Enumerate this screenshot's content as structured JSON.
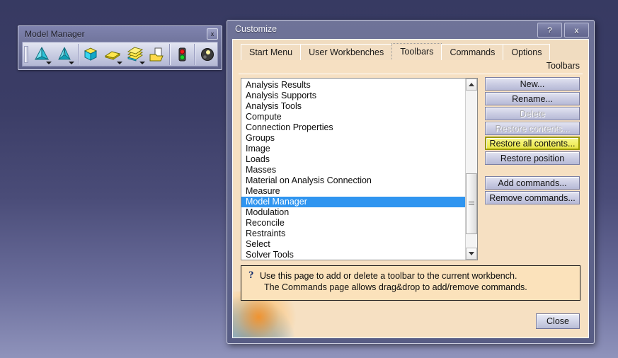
{
  "desktop": {
    "gradient_top": "#373a62",
    "gradient_bottom": "#8f93bb"
  },
  "model_manager_window": {
    "title": "Model Manager",
    "close_label": "x",
    "toolbar_groups": [
      {
        "buttons": [
          {
            "icon": "cone-mesh-icon",
            "has_dropdown": true
          },
          {
            "icon": "surface-mesh-icon",
            "has_dropdown": true
          }
        ]
      },
      {
        "buttons": [
          {
            "icon": "yellow-cube-icon",
            "has_dropdown": false
          },
          {
            "icon": "yellow-sheet-icon",
            "has_dropdown": true
          },
          {
            "icon": "yellow-stack-icon",
            "has_dropdown": true
          },
          {
            "icon": "open-folder-icon",
            "has_dropdown": false
          }
        ]
      },
      {
        "buttons": [
          {
            "icon": "traffic-light-icon",
            "has_dropdown": false
          }
        ]
      },
      {
        "buttons": [
          {
            "icon": "sphere-icon",
            "has_dropdown": false
          }
        ]
      }
    ]
  },
  "dialog": {
    "title": "Customize",
    "help_button_label": "?",
    "close_button_label": "x",
    "tabs": [
      {
        "label": "Start Menu",
        "active": false
      },
      {
        "label": "User Workbenches",
        "active": false
      },
      {
        "label": "Toolbars",
        "active": true
      },
      {
        "label": "Commands",
        "active": false
      },
      {
        "label": "Options",
        "active": false
      }
    ],
    "group_label": "Toolbars",
    "toolbar_list": {
      "items": [
        "Analysis Results",
        "Analysis Supports",
        "Analysis Tools",
        "Compute",
        "Connection Properties",
        "Groups",
        "Image",
        "Loads",
        "Masses",
        "Material on Analysis Connection",
        "Measure",
        "Model Manager",
        "Modulation",
        "Reconcile",
        "Restraints",
        "Select",
        "Solver Tools"
      ],
      "selected": "Model Manager",
      "selection_color": "#2f95f0"
    },
    "buttons": [
      {
        "label": "New...",
        "state": "enabled"
      },
      {
        "label": "Rename...",
        "state": "enabled"
      },
      {
        "label": "Delete",
        "state": "disabled"
      },
      {
        "label": "Restore contents...",
        "state": "disabled"
      },
      {
        "label": "Restore all contents...",
        "state": "highlighted"
      },
      {
        "label": "Restore position",
        "state": "enabled"
      },
      {
        "label": "Add commands...",
        "state": "enabled",
        "group_break": true
      },
      {
        "label": "Remove commands...",
        "state": "enabled"
      }
    ],
    "help": {
      "icon": "question-mark-icon",
      "line1": "Use this page to add or delete a toolbar to the current workbench.",
      "line2": "The Commands page allows drag&drop to add/remove commands."
    },
    "close_label": "Close",
    "highlight_color": "#f2f06a",
    "panel_color": "#f6e0c2"
  }
}
